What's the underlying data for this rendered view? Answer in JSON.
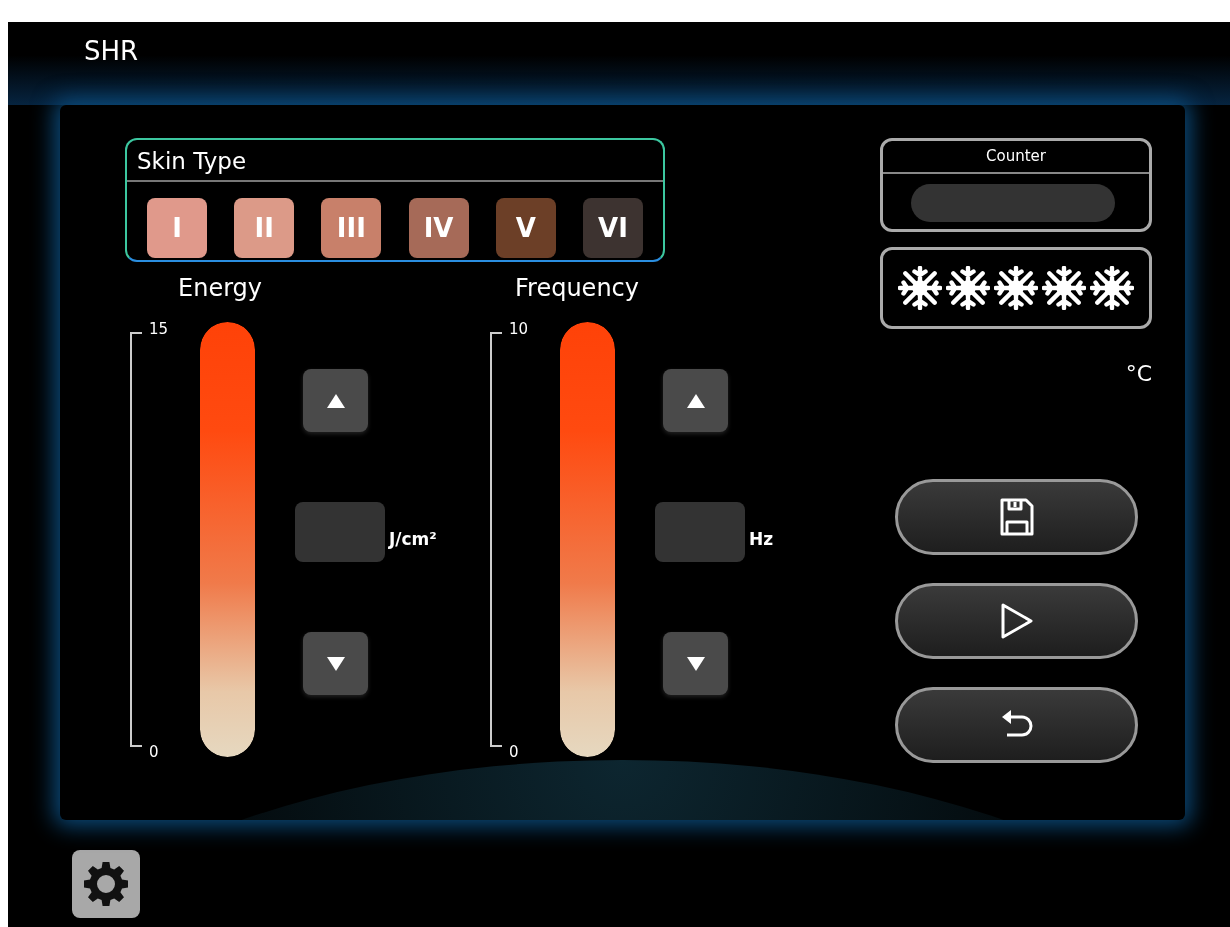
{
  "title": "SHR",
  "skin_type": {
    "label": "Skin Type",
    "types": [
      {
        "label": "I",
        "color": "#e0998b"
      },
      {
        "label": "II",
        "color": "#dc9a88"
      },
      {
        "label": "III",
        "color": "#c8806a"
      },
      {
        "label": "IV",
        "color": "#a66a58"
      },
      {
        "label": "V",
        "color": "#6c3f27"
      },
      {
        "label": "VI",
        "color": "#3d3330"
      }
    ]
  },
  "meters": [
    {
      "title": "Energy",
      "scale_max": "15",
      "scale_min": "0",
      "unit": "J/cm²"
    },
    {
      "title": "Frequency",
      "scale_max": "10",
      "scale_min": "0",
      "unit": "Hz"
    }
  ],
  "counter": {
    "label": "Counter"
  },
  "cooling": {
    "stars": 5,
    "unit": "°C"
  },
  "actions": [
    {
      "kind": "save"
    },
    {
      "kind": "play"
    },
    {
      "kind": "back"
    }
  ]
}
